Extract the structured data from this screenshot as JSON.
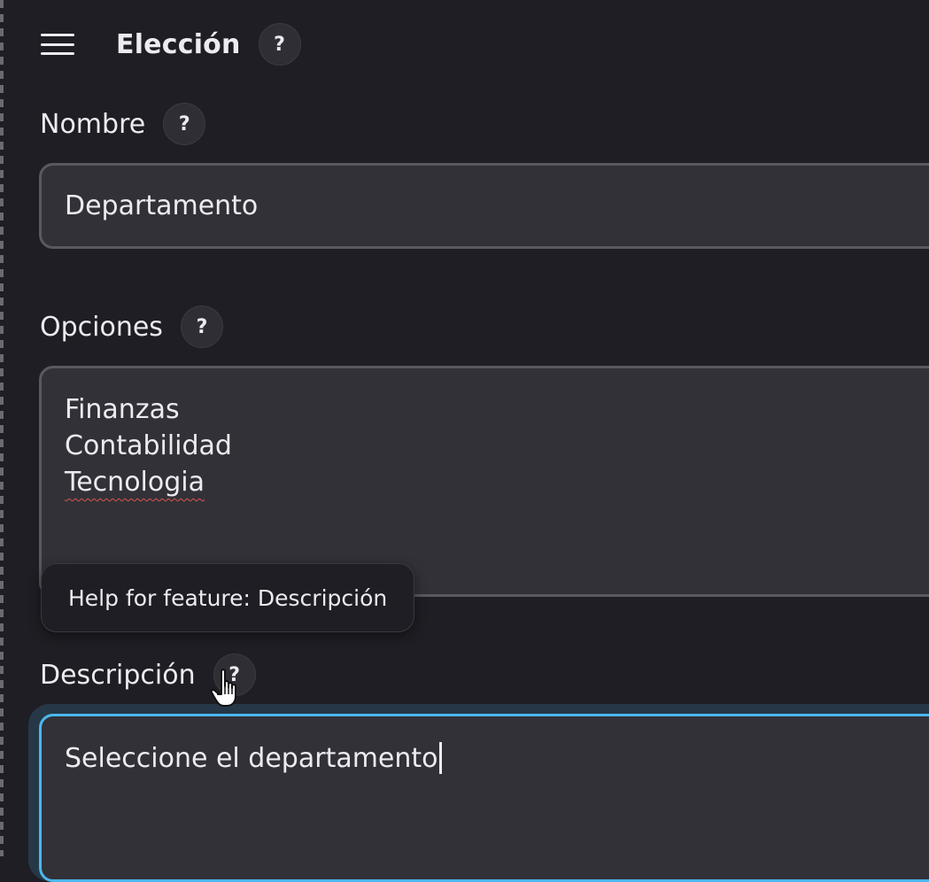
{
  "header": {
    "title": "Elección",
    "help_label": "?",
    "menu_icon": "hamburger-menu-icon"
  },
  "fields": {
    "name": {
      "label": "Nombre",
      "help_label": "?",
      "value": "Departamento"
    },
    "options": {
      "label": "Opciones",
      "help_label": "?",
      "lines": [
        "Finanzas",
        "Contabilidad",
        "Tecnologia"
      ]
    },
    "description": {
      "label": "Descripción",
      "help_label": "?",
      "value": "Seleccione el departamento"
    }
  },
  "tooltip": {
    "text": "Help for feature: Descripción"
  },
  "colors": {
    "background": "#1f1e24",
    "input_bg": "#323138",
    "input_border": "#5a5962",
    "focus_border": "#4cb8ee",
    "spellcheck": "#e0524f"
  },
  "cursor": {
    "icon": "pointer-hand-icon"
  }
}
